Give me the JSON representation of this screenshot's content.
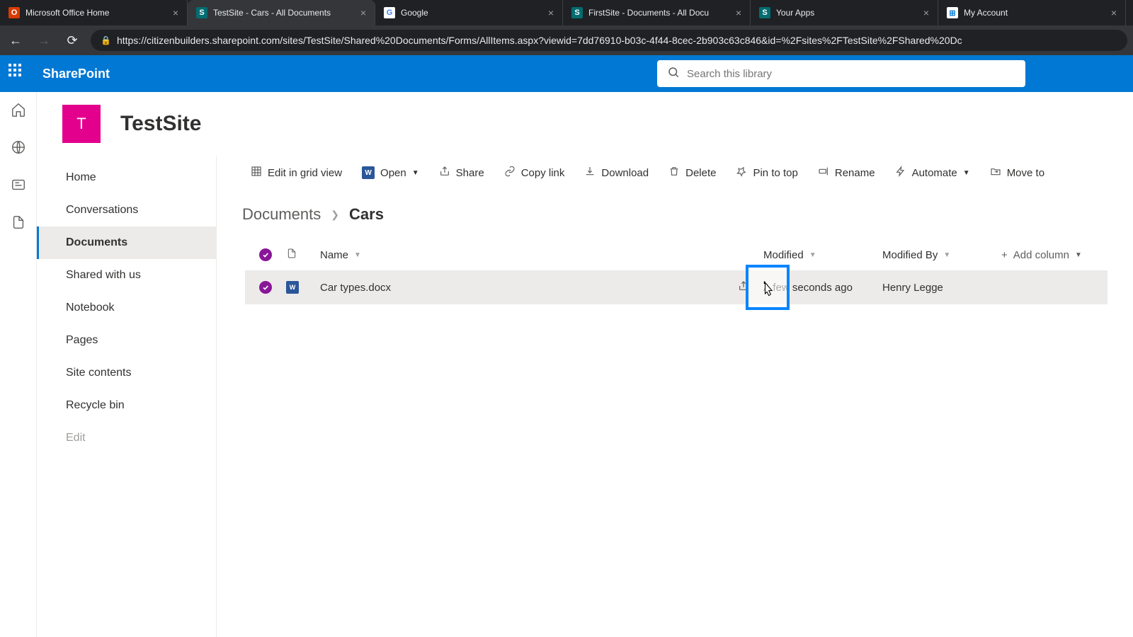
{
  "browser": {
    "tabs": [
      {
        "title": "Microsoft Office Home",
        "favicon_bg": "#d83b01",
        "favicon_txt": "O"
      },
      {
        "title": "TestSite - Cars - All Documents",
        "favicon_bg": "#036c70",
        "favicon_txt": "S",
        "active": true
      },
      {
        "title": "Google",
        "favicon_bg": "#ffffff",
        "favicon_txt": "G",
        "favicon_color": "#4285f4"
      },
      {
        "title": "FirstSite - Documents - All Docu",
        "favicon_bg": "#036c70",
        "favicon_txt": "S"
      },
      {
        "title": "Your Apps",
        "favicon_bg": "#036c70",
        "favicon_txt": "S"
      },
      {
        "title": "My Account",
        "favicon_bg": "#ffffff",
        "favicon_txt": "⊞",
        "favicon_color": "#0078d4"
      }
    ],
    "url": "https://citizenbuilders.sharepoint.com/sites/TestSite/Shared%20Documents/Forms/AllItems.aspx?viewid=7dd76910-b03c-4f44-8cec-2b903c63c846&id=%2Fsites%2FTestSite%2FShared%20Dc"
  },
  "suite": {
    "app_name": "SharePoint",
    "search_placeholder": "Search this library"
  },
  "site": {
    "logo_letter": "T",
    "title": "TestSite"
  },
  "left_nav": {
    "items": [
      "Home",
      "Conversations",
      "Documents",
      "Shared with us",
      "Notebook",
      "Pages",
      "Site contents",
      "Recycle bin",
      "Edit"
    ],
    "selected": "Documents"
  },
  "command_bar": {
    "edit_grid": "Edit in grid view",
    "open": "Open",
    "share": "Share",
    "copy_link": "Copy link",
    "download": "Download",
    "delete": "Delete",
    "pin": "Pin to top",
    "rename": "Rename",
    "automate": "Automate",
    "move_to": "Move to"
  },
  "breadcrumb": {
    "root": "Documents",
    "current": "Cars"
  },
  "table": {
    "headers": {
      "name": "Name",
      "modified": "Modified",
      "modified_by": "Modified By",
      "add_column": "Add column"
    },
    "rows": [
      {
        "name": "Car types.docx",
        "modified": "A few seconds ago",
        "modified_by": "Henry Legge"
      }
    ]
  }
}
